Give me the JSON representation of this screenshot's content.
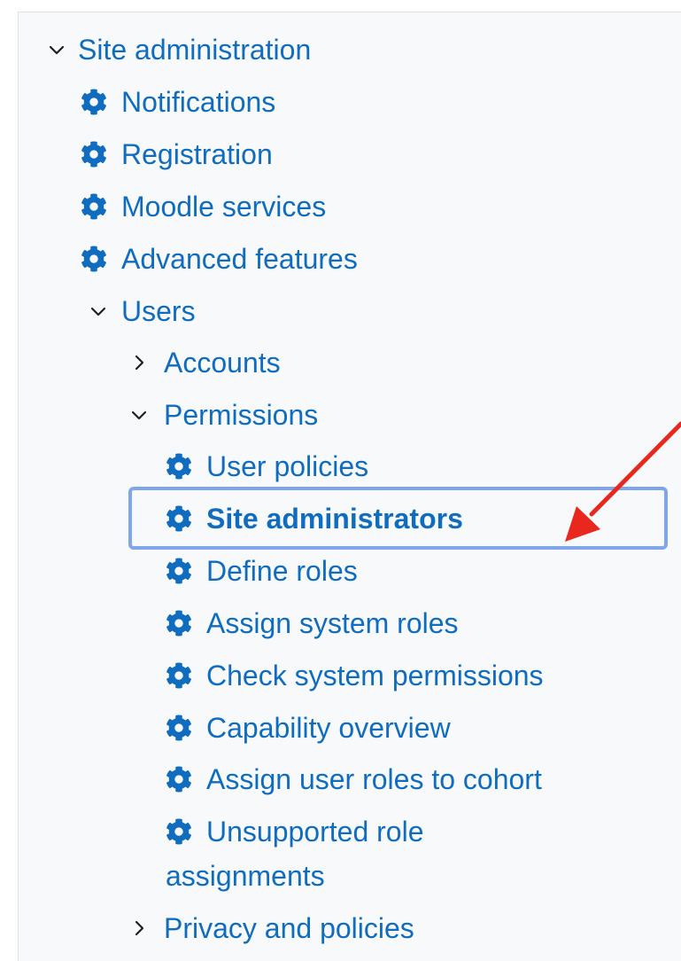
{
  "tree": {
    "site_administration": "Site administration",
    "notifications": "Notifications",
    "registration": "Registration",
    "moodle_services": "Moodle services",
    "advanced_features": "Advanced features",
    "users": "Users",
    "accounts": "Accounts",
    "permissions": "Permissions",
    "user_policies": "User policies",
    "site_administrators": "Site administrators",
    "define_roles": "Define roles",
    "assign_system_roles": "Assign system roles",
    "check_system_permissions": "Check system permissions",
    "capability_overview": "Capability overview",
    "assign_user_roles_to_cohort": "Assign user roles to cohort",
    "unsupported_role_assignments_line1": "Unsupported role",
    "unsupported_role_assignments_line2": "assignments",
    "privacy_and_policies": "Privacy and policies"
  },
  "icons": {
    "expanded": "chevron-down-icon",
    "collapsed": "chevron-right-icon",
    "item": "gear-icon"
  },
  "colors": {
    "link": "#0f6cbf",
    "highlight_border": "#7fa6ea",
    "annotation_arrow": "#e8281e",
    "panel_background": "#f8f9fa"
  }
}
